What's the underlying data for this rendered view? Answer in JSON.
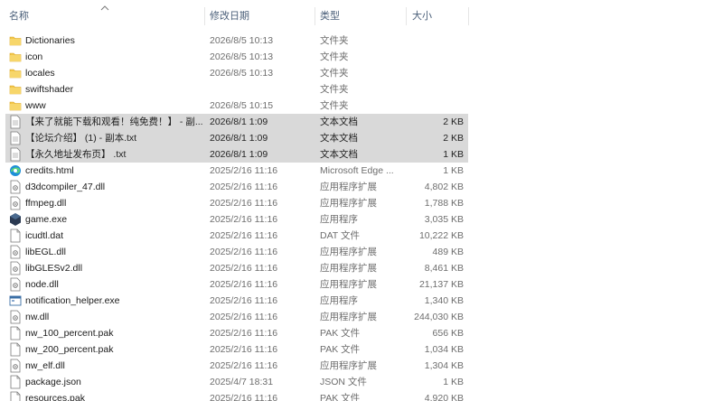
{
  "columns": {
    "name": "名称",
    "date": "修改日期",
    "type": "类型",
    "size": "大小"
  },
  "files": [
    {
      "name": "Dictionaries",
      "date": "2026/8/5 10:13",
      "type": "文件夹",
      "size": "",
      "icon": "folder-icon",
      "selected": false
    },
    {
      "name": "icon",
      "date": "2026/8/5 10:13",
      "type": "文件夹",
      "size": "",
      "icon": "folder-icon",
      "selected": false
    },
    {
      "name": "locales",
      "date": "2026/8/5 10:13",
      "type": "文件夹",
      "size": "",
      "icon": "folder-icon",
      "selected": false
    },
    {
      "name": "swiftshader",
      "date": "",
      "type": "文件夹",
      "size": "",
      "icon": "folder-icon",
      "selected": false
    },
    {
      "name": "www",
      "date": "2026/8/5 10:15",
      "type": "文件夹",
      "size": "",
      "icon": "folder-icon",
      "selected": false
    },
    {
      "name": "【来了就能下载和观看！纯免费！】 - 副...",
      "date": "2026/8/1 1:09",
      "type": "文本文档",
      "size": "2 KB",
      "icon": "text-file-icon",
      "selected": true
    },
    {
      "name": "【论坛介绍】 (1) - 副本.txt",
      "date": "2026/8/1 1:09",
      "type": "文本文档",
      "size": "2 KB",
      "icon": "text-file-icon",
      "selected": true
    },
    {
      "name": "【永久地址发布页】 .txt",
      "date": "2026/8/1 1:09",
      "type": "文本文档",
      "size": "1 KB",
      "icon": "text-file-icon",
      "selected": true
    },
    {
      "name": "credits.html",
      "date": "2025/2/16 11:16",
      "type": "Microsoft Edge ...",
      "size": "1 KB",
      "icon": "edge-icon",
      "selected": false
    },
    {
      "name": "d3dcompiler_47.dll",
      "date": "2025/2/16 11:16",
      "type": "应用程序扩展",
      "size": "4,802 KB",
      "icon": "dll-file-icon",
      "selected": false
    },
    {
      "name": "ffmpeg.dll",
      "date": "2025/2/16 11:16",
      "type": "应用程序扩展",
      "size": "1,788 KB",
      "icon": "dll-file-icon",
      "selected": false
    },
    {
      "name": "game.exe",
      "date": "2025/2/16 11:16",
      "type": "应用程序",
      "size": "3,035 KB",
      "icon": "game-exe-icon",
      "selected": false
    },
    {
      "name": "icudtl.dat",
      "date": "2025/2/16 11:16",
      "type": "DAT 文件",
      "size": "10,222 KB",
      "icon": "blank-file-icon",
      "selected": false
    },
    {
      "name": "libEGL.dll",
      "date": "2025/2/16 11:16",
      "type": "应用程序扩展",
      "size": "489 KB",
      "icon": "dll-file-icon",
      "selected": false
    },
    {
      "name": "libGLESv2.dll",
      "date": "2025/2/16 11:16",
      "type": "应用程序扩展",
      "size": "8,461 KB",
      "icon": "dll-file-icon",
      "selected": false
    },
    {
      "name": "node.dll",
      "date": "2025/2/16 11:16",
      "type": "应用程序扩展",
      "size": "21,137 KB",
      "icon": "dll-file-icon",
      "selected": false
    },
    {
      "name": "notification_helper.exe",
      "date": "2025/2/16 11:16",
      "type": "应用程序",
      "size": "1,340 KB",
      "icon": "exe-window-icon",
      "selected": false
    },
    {
      "name": "nw.dll",
      "date": "2025/2/16 11:16",
      "type": "应用程序扩展",
      "size": "244,030 KB",
      "icon": "dll-file-icon",
      "selected": false
    },
    {
      "name": "nw_100_percent.pak",
      "date": "2025/2/16 11:16",
      "type": "PAK 文件",
      "size": "656 KB",
      "icon": "blank-file-icon",
      "selected": false
    },
    {
      "name": "nw_200_percent.pak",
      "date": "2025/2/16 11:16",
      "type": "PAK 文件",
      "size": "1,034 KB",
      "icon": "blank-file-icon",
      "selected": false
    },
    {
      "name": "nw_elf.dll",
      "date": "2025/2/16 11:16",
      "type": "应用程序扩展",
      "size": "1,304 KB",
      "icon": "dll-file-icon",
      "selected": false
    },
    {
      "name": "package.json",
      "date": "2025/4/7 18:31",
      "type": "JSON 文件",
      "size": "1 KB",
      "icon": "blank-file-icon",
      "selected": false
    },
    {
      "name": "resources.pak",
      "date": "2025/2/16 11:16",
      "type": "PAK 文件",
      "size": "4,920 KB",
      "icon": "blank-file-icon",
      "selected": false
    }
  ],
  "colors": {
    "selection": "#d9d9d9",
    "header_text": "#4c607a",
    "folder": "#f3c74a"
  }
}
